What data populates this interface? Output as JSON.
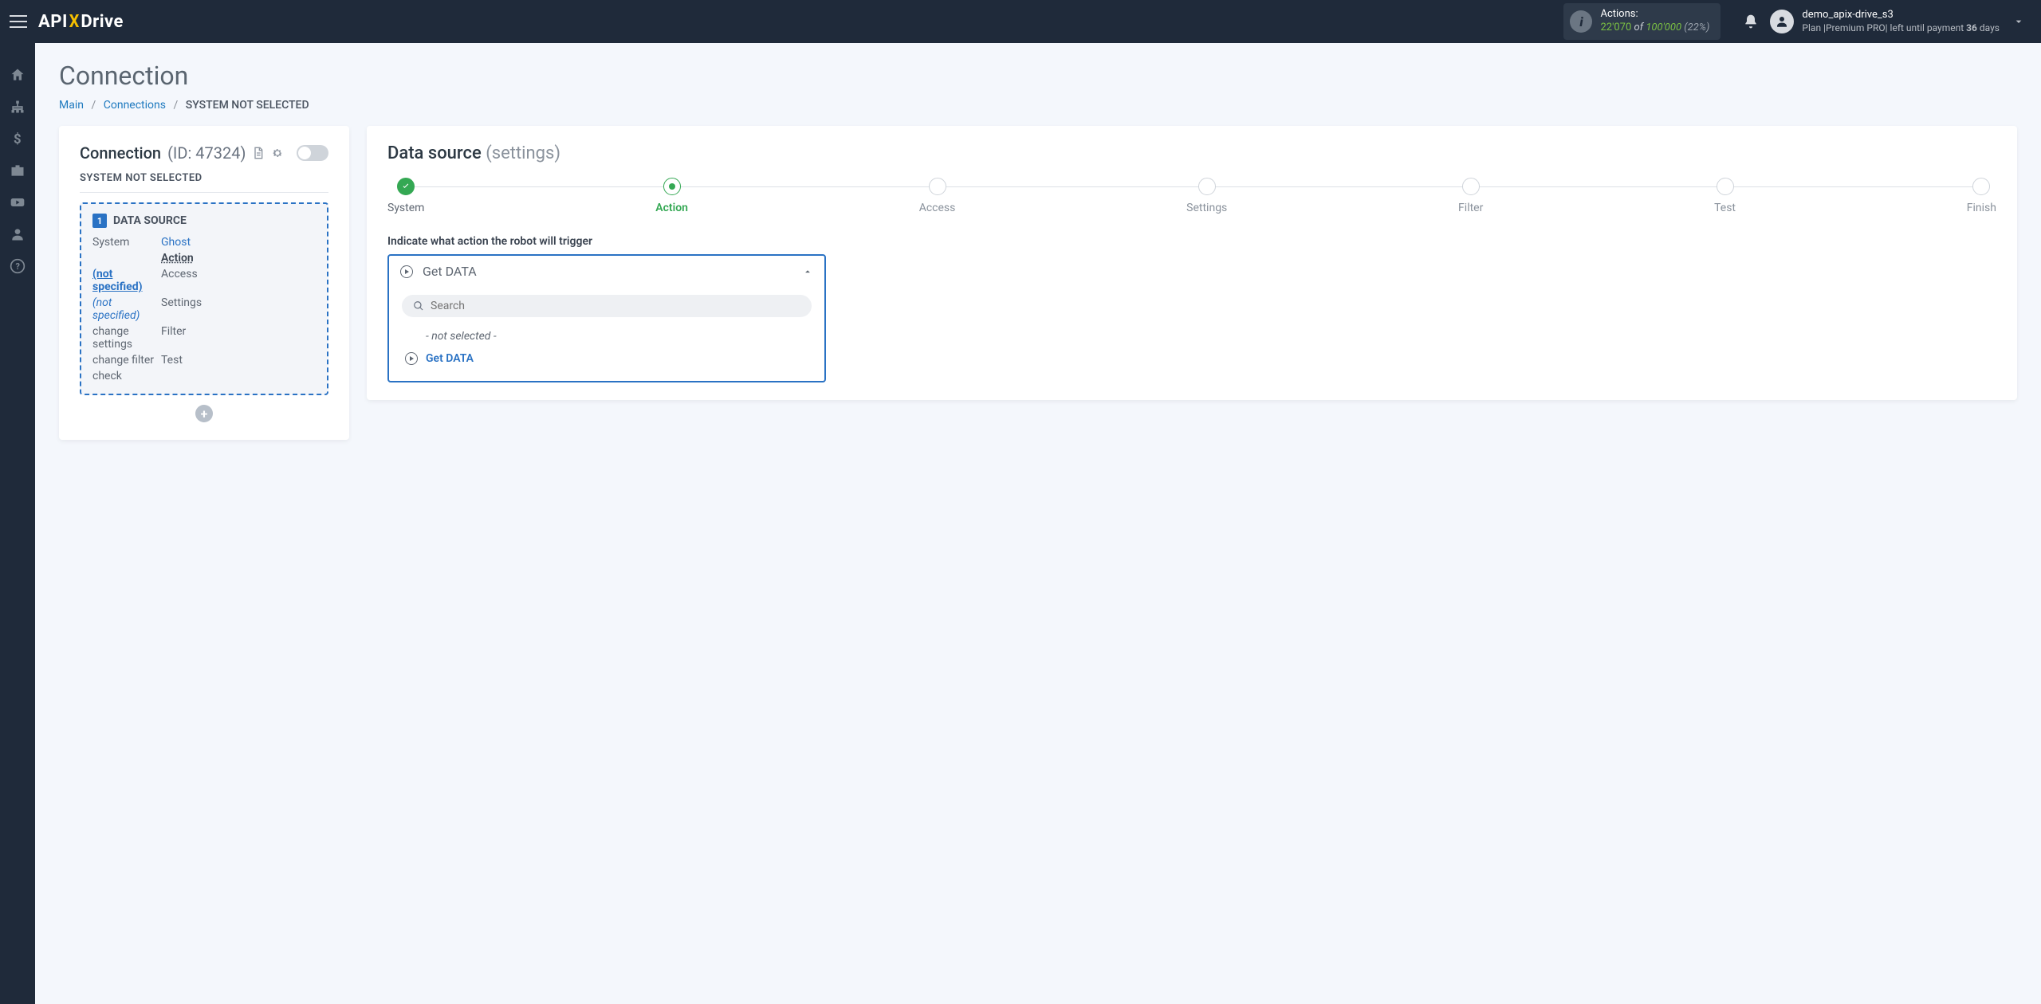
{
  "header": {
    "logo_pre": "API",
    "logo_x": "X",
    "logo_post": "Drive",
    "actions_label": "Actions:",
    "actions_used": "22'070",
    "actions_of": "of",
    "actions_total": "100'000",
    "actions_pct": "(22%)",
    "user_name": "demo_apix-drive_s3",
    "plan_pre": "Plan |Premium PRO| left until payment ",
    "plan_days": "36",
    "plan_suffix": " days"
  },
  "page": {
    "title": "Connection",
    "breadcrumb": {
      "main": "Main",
      "connections": "Connections",
      "current": "SYSTEM NOT SELECTED"
    }
  },
  "left": {
    "conn_label": "Connection",
    "conn_id": "(ID: 47324)",
    "sys_not_selected": "SYSTEM NOT SELECTED",
    "ds_badge": "1",
    "ds_title": "DATA SOURCE",
    "rows": {
      "system": {
        "k": "System",
        "v": "Ghost"
      },
      "action": {
        "k": "Action",
        "v": "(not specified)"
      },
      "access": {
        "k": "Access",
        "v": "(not specified)"
      },
      "settings": {
        "k": "Settings",
        "v": "change settings"
      },
      "filter": {
        "k": "Filter",
        "v": "change filter"
      },
      "test": {
        "k": "Test",
        "v": "check"
      }
    }
  },
  "right": {
    "heading_strong": "Data source",
    "heading_soft": "(settings)",
    "steps": {
      "system": "System",
      "action": "Action",
      "access": "Access",
      "settings": "Settings",
      "filter": "Filter",
      "test": "Test",
      "finish": "Finish"
    },
    "prompt": "Indicate what action the robot will trigger",
    "select_value": "Get DATA",
    "search_placeholder": "Search",
    "option_none": "- not selected -",
    "option_get": "Get DATA"
  }
}
